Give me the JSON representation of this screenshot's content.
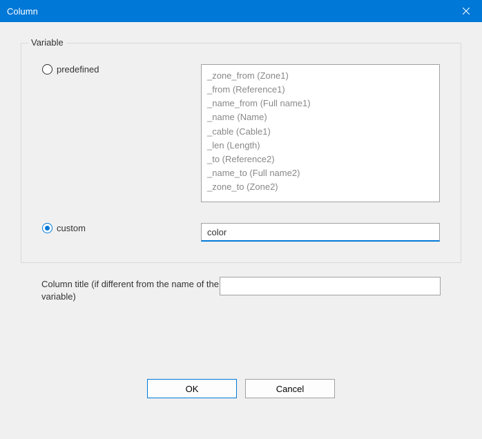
{
  "titlebar": {
    "title": "Column"
  },
  "fieldset": {
    "legend": "Variable",
    "predefined": {
      "label": "predefined",
      "selected": false,
      "items": [
        "_zone_from (Zone1)",
        "_from (Reference1)",
        "_name_from (Full name1)",
        "_name (Name)",
        "_cable (Cable1)",
        "_len (Length)",
        "_to (Reference2)",
        "_name_to (Full name2)",
        "_zone_to (Zone2)"
      ]
    },
    "custom": {
      "label": "custom",
      "selected": true,
      "value": "color"
    }
  },
  "columnTitle": {
    "label": "Column title (if different from the name of the variable)",
    "value": ""
  },
  "buttons": {
    "ok": "OK",
    "cancel": "Cancel"
  }
}
